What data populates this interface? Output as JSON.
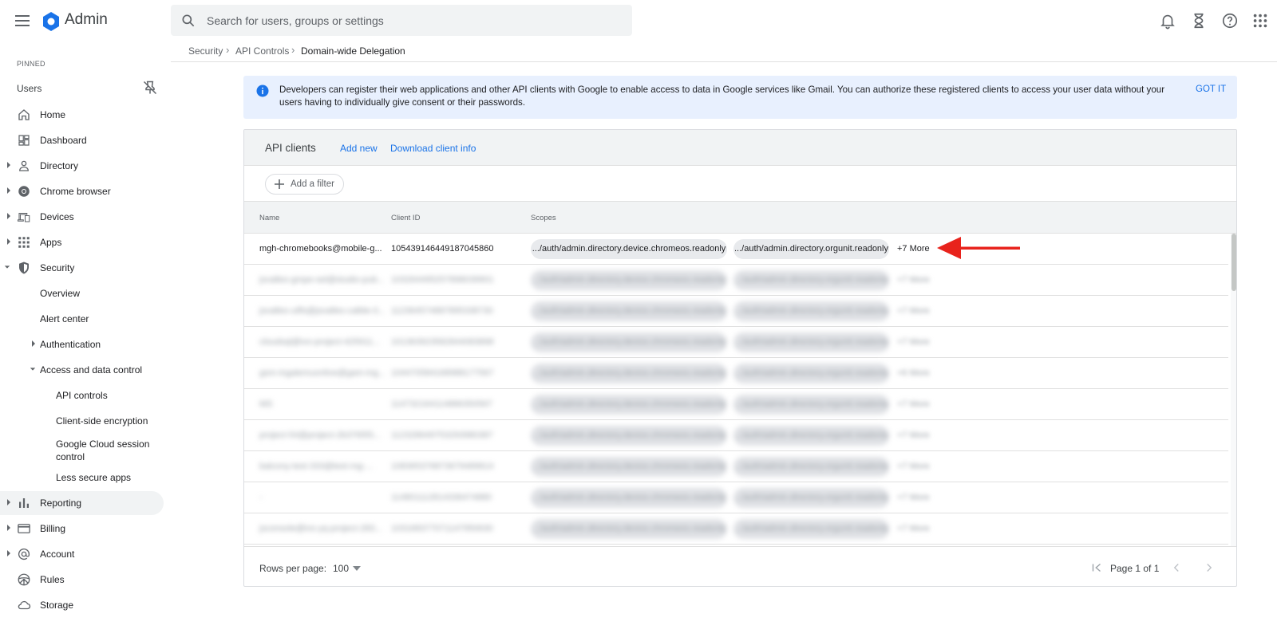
{
  "app": {
    "title": "Admin"
  },
  "search": {
    "placeholder": "Search for users, groups or settings"
  },
  "breadcrumb": [
    "Security",
    "API Controls",
    "Domain-wide Delegation"
  ],
  "sidebar": {
    "pinned_label": "PINNED",
    "users_label": "Users",
    "items": [
      {
        "label": "Home",
        "icon": "home-icon"
      },
      {
        "label": "Dashboard",
        "icon": "dashboard-icon"
      },
      {
        "label": "Directory",
        "icon": "person-icon"
      },
      {
        "label": "Chrome browser",
        "icon": "chrome-icon"
      },
      {
        "label": "Devices",
        "icon": "devices-icon"
      },
      {
        "label": "Apps",
        "icon": "apps-grid-icon"
      },
      {
        "label": "Security",
        "icon": "shield-icon"
      },
      {
        "label": "Overview"
      },
      {
        "label": "Alert center"
      },
      {
        "label": "Authentication"
      },
      {
        "label": "Access and data control"
      },
      {
        "label": "API controls"
      },
      {
        "label": "Client-side encryption"
      },
      {
        "label": "Google Cloud session control"
      },
      {
        "label": "Less secure apps"
      },
      {
        "label": "Reporting",
        "icon": "bar-chart-icon"
      },
      {
        "label": "Billing",
        "icon": "credit-card-icon"
      },
      {
        "label": "Account",
        "icon": "at-sign-icon"
      },
      {
        "label": "Rules",
        "icon": "steering-wheel-icon"
      },
      {
        "label": "Storage",
        "icon": "cloud-icon"
      }
    ]
  },
  "banner": {
    "text": "Developers can register their web applications and other API clients with Google to enable access to data in Google services like Gmail. You can authorize these registered clients to access your user data without your users having to individually give consent or their passwords.",
    "action": "GOT IT"
  },
  "card": {
    "title": "API clients",
    "add_new": "Add new",
    "download": "Download client info",
    "filter": "Add a filter",
    "columns": {
      "name": "Name",
      "client_id": "Client ID",
      "scopes": "Scopes"
    },
    "rows": [
      {
        "name": "mgh-chromebooks@mobile-g...",
        "client_id": "105439146449187045860",
        "scope1": ".../auth/admin.directory.device.chromeos.readonly",
        "scope2": ".../auth/admin.directory.orgunit.readonly",
        "more": "+7 More"
      },
      {
        "name": "jsvalles-gmpe-sel@studio-pub...",
        "client_id": "103264495257898039901",
        "scope1": ".../auth/admin.directory.device.chromeos.readonly",
        "scope2": ".../auth/admin.directory.orgunit.readonly",
        "more": "+7 More"
      },
      {
        "name": "jsvalles-uilfs@jsvalles-calble-0...",
        "client_id": "112364574887895338730",
        "scope1": ".../auth/admin.directory.device.chromeos.readonly",
        "scope2": ".../auth/admin.directory.orgunit.readonly",
        "more": "+7 More"
      },
      {
        "name": "cloudsql@ivo-project-425911...",
        "client_id": "101363923582844083898",
        "scope1": ".../auth/admin.directory.device.chromeos.readonly",
        "scope2": ".../auth/admin.directory.orgunit.readonly",
        "more": "+7 More"
      },
      {
        "name": "gsm-ingalemuonlive@gam-ing...",
        "client_id": "104470584168988177567",
        "scope1": ".../auth/admin.directory.device.chromeos.readonly",
        "scope2": ".../auth/admin.directory.orgunit.readonly",
        "more": "+6 More"
      },
      {
        "name": "MS",
        "client_id": "114732164114886350567",
        "scope1": ".../auth/admin.directory.device.chromeos.readonly",
        "scope2": ".../auth/admin.directory.orgunit.readonly",
        "more": "+7 More"
      },
      {
        "name": "project-54@project-2b3765f3...",
        "client_id": "112328649753293980387",
        "scope1": ".../auth/admin.directory.device.chromeos.readonly",
        "scope2": ".../auth/admin.directory.orgunit.readonly",
        "more": "+7 More"
      },
      {
        "name": "balcony-test-333@test-mg-...",
        "client_id": "108365376873679489814",
        "scope1": ".../auth/admin.directory.device.chromeos.readonly",
        "scope2": ".../auth/admin.directory.orgunit.readonly",
        "more": "+7 More"
      },
      {
        "name": "-",
        "client_id": "114801112814336474880",
        "scope1": ".../auth/admin.directory.device.chromeos.readonly",
        "scope2": ".../auth/admin.directory.orgunit.readonly",
        "more": "+7 More"
      },
      {
        "name": "jsconsole@ivs-yq-project-283...",
        "client_id": "103168377071147950630",
        "scope1": ".../auth/admin.directory.device.chromeos.readonly",
        "scope2": ".../auth/admin.directory.orgunit.readonly",
        "more": "+7 More"
      }
    ],
    "rows_per_page_label": "Rows per page:",
    "rows_per_page_value": "100",
    "page_label": "Page 1 of 1"
  },
  "colors": {
    "accent": "#1a73e8",
    "banner_bg": "#e8f0fe",
    "arrow": "#e8231c"
  }
}
